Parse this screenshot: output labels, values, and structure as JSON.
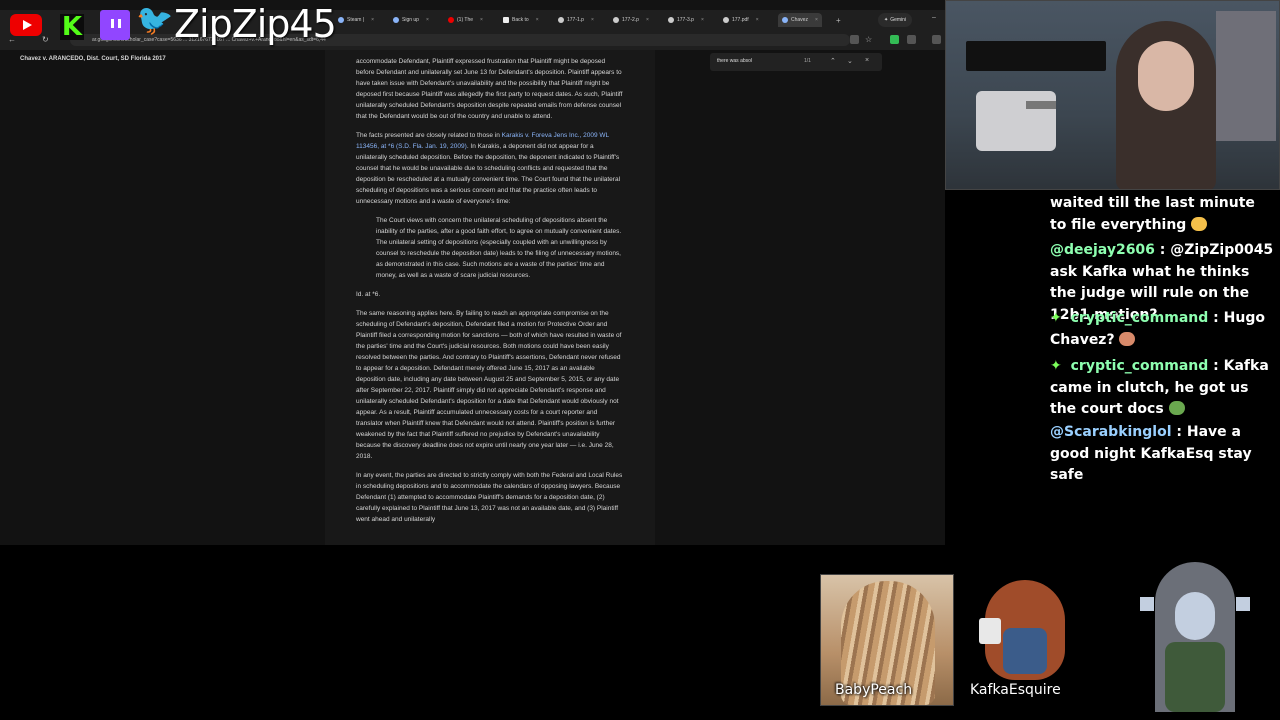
{
  "overlay": {
    "handle": "ZipZip45",
    "icons": [
      "youtube-icon",
      "kick-icon",
      "twitch-icon",
      "twitter-icon"
    ]
  },
  "browser": {
    "tabs": [
      {
        "label": "Steam |"
      },
      {
        "label": "Sign up"
      },
      {
        "label": "(1) The"
      },
      {
        "label": "Back to"
      },
      {
        "label": "177-1.p"
      },
      {
        "label": "177-2.p"
      },
      {
        "label": "177-3.p"
      },
      {
        "label": "177.pdf"
      },
      {
        "label": "Chavez"
      }
    ],
    "gemini_label": "Gemini",
    "url": "ar.google.com/scholar_case?case=5636 ... 3121676775167 ... Chavez+v.+Arancedo&hl=en&as_sdt=6,44",
    "find": {
      "query": "there was absol",
      "count": "1/1"
    }
  },
  "document": {
    "case_header": "Chavez v. ARANCEDO, Dist. Court, SD Florida 2017",
    "para1": "accommodate Defendant, Plaintiff expressed frustration that Plaintiff might be deposed before Defendant and unilaterally set June 13 for Defendant's deposition. Plaintiff appears to have taken issue with Defendant's unavailability and the possibility that Plaintiff might be deposed first because Plaintiff was allegedly the first party to request dates. As such, Plaintiff unilaterally scheduled Defendant's deposition despite repeated emails from defense counsel that the Defendant would be out of the country and unable to attend.",
    "para2_pre": "The facts presented are closely related to those in ",
    "para2_link": "Karakis v. Foreva Jens Inc., 2009 WL 113456, at *6 (S.D. Fla. Jan. 19, 2009)",
    "para2_post": ". In Karakis, a deponent did not appear for a unilaterally scheduled deposition. Before the deposition, the deponent indicated to Plaintiff's counsel that he would be unavailable due to scheduling conflicts and requested that the deposition be rescheduled at a mutually convenient time. The Court found that the unilateral scheduling of depositions was a serious concern and that the practice often leads to unnecessary motions and a waste of everyone's time:",
    "quote": "The Court views with concern the unilateral scheduling of depositions absent the inability of the parties, after a good faith effort, to agree on mutually convenient dates. The unilateral setting of depositions (especially coupled with an unwillingness by counsel to reschedule the deposition date) leads to the filing of unnecessary motions, as demonstrated in this case. Such motions are a waste of the parties' time and money, as well as a waste of scare judicial resources.",
    "idcite": "Id. at *6.",
    "para3": "The same reasoning applies here. By failing to reach an appropriate compromise on the scheduling of Defendant's deposition, Defendant filed a motion for Protective Order and Plaintiff filed a corresponding motion for sanctions — both of which have resulted in waste of the parties' time and the Court's judicial resources. Both motions could have been easily resolved between the parties. And contrary to Plaintiff's assertions, Defendant never refused to appear for a deposition. Defendant merely offered June 15, 2017 as an available deposition date, including any date between August 25 and September 5, 2015, or any date after September 22, 2017. Plaintiff simply did not appreciate Defendant's response and unilaterally scheduled Defendant's deposition for a date that Defendant would obviously not appear. As a result, Plaintiff accumulated unnecessary costs for a court reporter and translator when Plaintiff knew that Defendant would not attend. Plaintiff's position is further weakened by the fact that Plaintiff suffered no prejudice by Defendant's unavailability because the discovery deadline does not expire until nearly one year later — i.e. June 28, 2018.",
    "para4": "In any event, the parties are directed to strictly comply with both the Federal and Local Rules in scheduling depositions and to accommodate the calendars of opposing lawyers. Because Defendant (1) attempted to accommodate Plaintiff's demands for a deposition date, (2) carefully explained to Plaintiff that June 13, 2017 was not an available date, and (3) Plaintiff went ahead and unilaterally"
  },
  "chat": {
    "messages": [
      {
        "user": "",
        "text": "waited till the last minute to file everything"
      },
      {
        "user": "@deejay2606",
        "text": ": @ZipZip0045 ask Kafka what he thinks the judge will rule on the 12b1 motion?"
      },
      {
        "user": "cryptic_command",
        "text": ": Hugo Chavez?"
      },
      {
        "user": "cryptic_command",
        "text": ": Kafka came in clutch, he got us the court docs"
      },
      {
        "user": "@Scarabkinglol",
        "text": ": Have a good night KafkaEsq stay safe"
      }
    ]
  },
  "avatars": [
    {
      "label": "BabyPeach"
    },
    {
      "label": "KafkaEsquire"
    }
  ],
  "colors": {
    "username_green": "#8effb0",
    "username_blue": "#9ad0ff",
    "badge_green": "#7cff5b",
    "link_blue": "#8ab4f8"
  }
}
